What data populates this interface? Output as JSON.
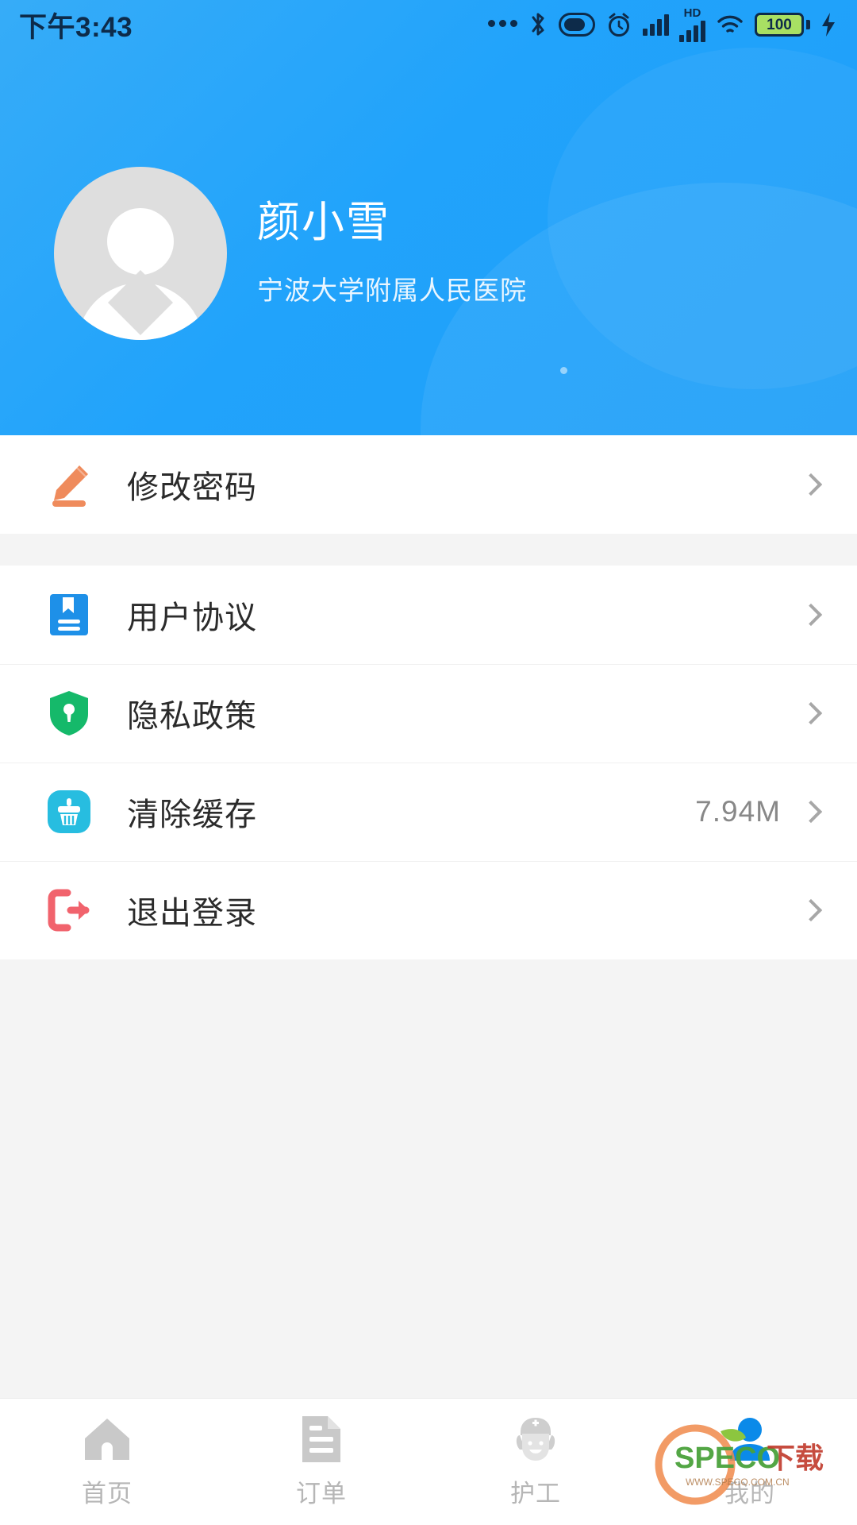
{
  "statusbar": {
    "time": "下午3:43",
    "battery_level": "100",
    "hd_label": "HD",
    "icons": [
      "more-dots-icon",
      "bluetooth-icon",
      "vpn-pill-icon",
      "alarm-clock-icon",
      "signal-bars-icon",
      "hd-signal-bars-icon",
      "wifi-icon",
      "battery-icon",
      "charging-bolt-icon"
    ]
  },
  "header": {
    "user_name": "颜小雪",
    "organization": "宁波大学附属人民医院",
    "avatar_icon": "default-user-avatar",
    "bg_color": "#21a3fb"
  },
  "sections": [
    {
      "rows": [
        {
          "icon": "pencil-edit-icon",
          "label": "修改密码",
          "value": "",
          "color": "#ef8b5c"
        }
      ]
    },
    {
      "rows": [
        {
          "icon": "document-agreement-icon",
          "label": "用户协议",
          "value": "",
          "color": "#1e90e8"
        },
        {
          "icon": "shield-lock-icon",
          "label": "隐私政策",
          "value": "",
          "color": "#15b96a"
        },
        {
          "icon": "broom-clean-icon",
          "label": "清除缓存",
          "value": "7.94M",
          "color": "#27bde0"
        },
        {
          "icon": "logout-arrow-icon",
          "label": "退出登录",
          "value": "",
          "color": "#f1636d"
        }
      ]
    }
  ],
  "tabbar": {
    "items": [
      {
        "icon": "home-icon",
        "label": "首页",
        "active": false
      },
      {
        "icon": "orders-doc-icon",
        "label": "订单",
        "active": false
      },
      {
        "icon": "nurse-icon",
        "label": "护工",
        "active": false
      },
      {
        "icon": "person-profile-icon",
        "label": "我的",
        "active": true
      }
    ],
    "active_color": "#1e90e8",
    "inactive_color": "#c9c9c9"
  },
  "watermark": {
    "text": "SPECO下载",
    "sub": "WWW.SPECO.COM.CN"
  }
}
